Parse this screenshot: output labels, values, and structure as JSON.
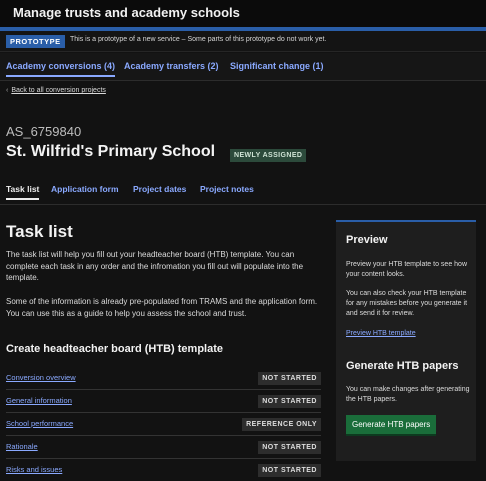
{
  "header": {
    "title": "Manage trusts and academy schools"
  },
  "prototype_banner": {
    "tag": "PROTOTYPE",
    "message": "This is a prototype of a new service – Some parts of this prototype do not work yet."
  },
  "top_tabs": [
    {
      "label": "Academy conversions (4)",
      "active": true
    },
    {
      "label": "Academy transfers (2)",
      "active": false
    },
    {
      "label": "Significant change (1)",
      "active": false
    }
  ],
  "back_link": {
    "label": "Back to all conversion projects"
  },
  "project": {
    "urn": "AS_6759840",
    "school_name": "St. Wilfrid's Primary School",
    "status_badge": "NEWLY ASSIGNED"
  },
  "sub_tabs": [
    {
      "label": "Task list",
      "active": true
    },
    {
      "label": "Application form",
      "active": false
    },
    {
      "label": "Project dates",
      "active": false
    },
    {
      "label": "Project notes",
      "active": false
    }
  ],
  "main": {
    "heading": "Task list",
    "paragraph_1": "The task list will help you fill out your headteacher board (HTB) template. You can complete each task in any order and the infromation you fill out will populate into the template.",
    "paragraph_2": "Some of the information is already pre-populated from TRAMS and the application form. You can use this as a guide to help you assess the school and trust.",
    "section_heading": "Create headteacher board (HTB) template",
    "tasks": [
      {
        "label": "Conversion overview",
        "status": "NOT STARTED"
      },
      {
        "label": "General information",
        "status": "NOT STARTED"
      },
      {
        "label": "School performance",
        "status": "REFERENCE ONLY"
      },
      {
        "label": "Rationale",
        "status": "NOT STARTED"
      },
      {
        "label": "Risks and issues",
        "status": "NOT STARTED"
      }
    ]
  },
  "sidebar": {
    "preview_heading": "Preview",
    "preview_text_1": "Preview your HTB template to see how your content looks.",
    "preview_text_2": "You can also check your HTB template for any mistakes before you generate it and send it for review.",
    "preview_link": "Preview HTB template",
    "generate_heading": "Generate HTB papers",
    "generate_text": "You can make changes after generating the HTB papers.",
    "generate_button": "Generate HTB papers"
  },
  "colors": {
    "link": "#8aa9ff",
    "brand_blue": "#2a5ea8",
    "button_green": "#1a6d3a",
    "background": "#121212"
  }
}
